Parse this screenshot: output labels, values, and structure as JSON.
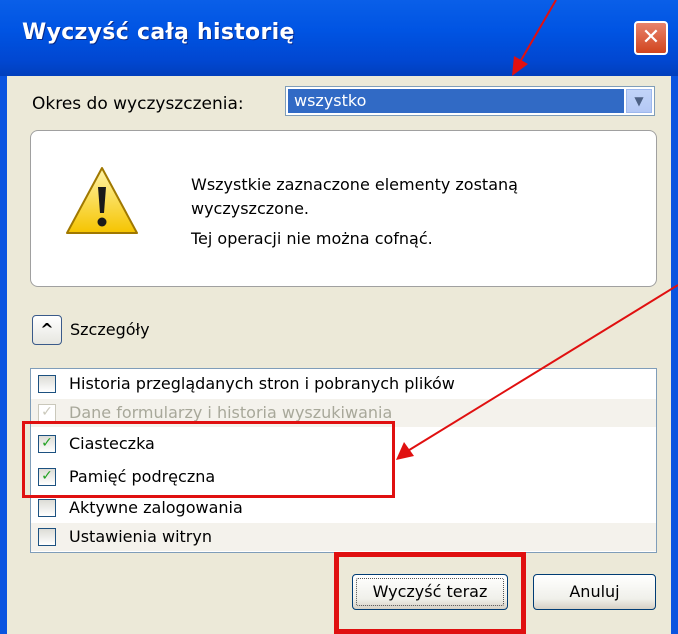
{
  "dialog": {
    "title": "Wyczyść całą historię",
    "close_symbol": "✕"
  },
  "period": {
    "label": "Okres do wyczyszczenia:",
    "value": "wszystko",
    "arrow_symbol": "▼"
  },
  "warning": {
    "icon": "warning-triangle-icon",
    "line1": "Wszystkie zaznaczone elementy zostaną wyczyszczone.",
    "line2": "Tej operacji nie można cofnąć."
  },
  "details": {
    "toggle_symbol": "^",
    "label": "Szczegóły"
  },
  "items": [
    {
      "label": "Historia przeglądanych stron i pobranych plików",
      "checked": false,
      "disabled": false
    },
    {
      "label": "Dane formularzy i historia wyszukiwania",
      "checked": true,
      "disabled": true
    },
    {
      "label": "Ciasteczka",
      "checked": true,
      "disabled": false
    },
    {
      "label": "Pamięć podręczna",
      "checked": true,
      "disabled": false
    },
    {
      "label": "Aktywne zalogowania",
      "checked": false,
      "disabled": false
    },
    {
      "label": "Ustawienia witryn",
      "checked": false,
      "disabled": false
    }
  ],
  "buttons": {
    "clear_now": "Wyczyść teraz",
    "cancel": "Anuluj"
  },
  "check_symbol": "✓",
  "colors": {
    "titlebar": "#0054e3",
    "selection": "#316ac5",
    "annotation_red": "#e01010",
    "check_green": "#21a121"
  }
}
